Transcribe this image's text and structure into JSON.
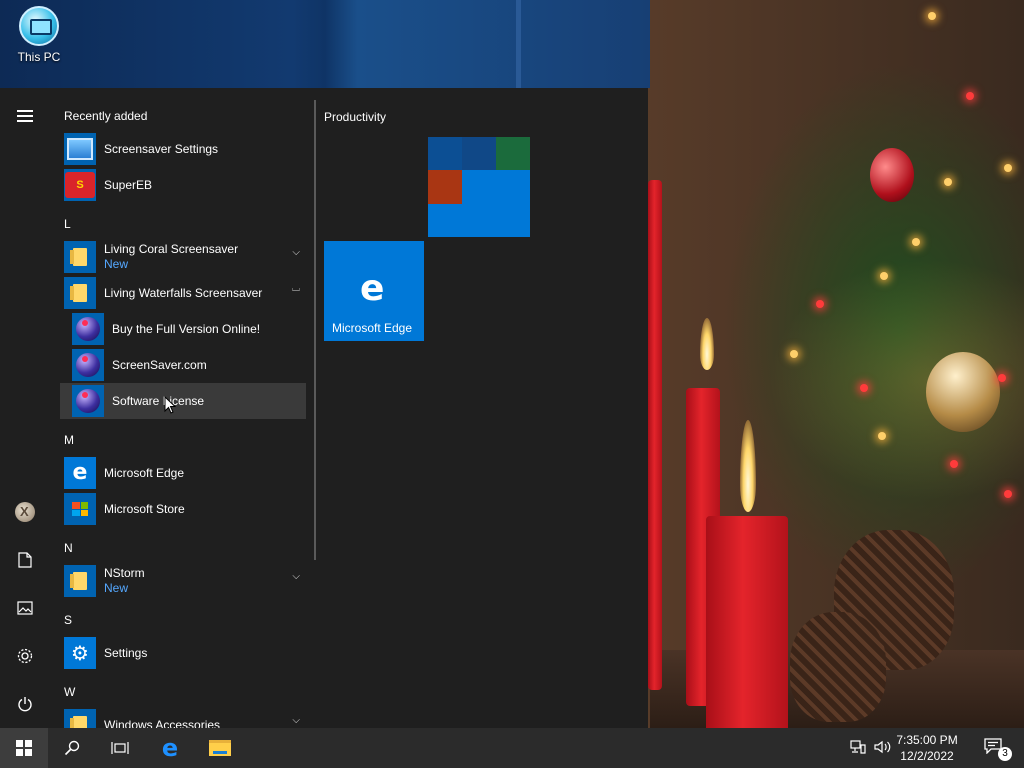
{
  "desktop": {
    "icons": [
      {
        "label": "This PC",
        "icon": "this-pc-icon"
      }
    ]
  },
  "start_menu": {
    "rail": [
      "hamburger-icon",
      "user-avatar",
      "documents-icon",
      "pictures-icon",
      "settings-gear-icon",
      "power-icon"
    ],
    "sections": {
      "recently_added": "Recently added",
      "l": "L",
      "m": "M",
      "n": "N",
      "s": "S",
      "w": "W"
    },
    "apps": {
      "screensaver_settings": "Screensaver Settings",
      "supereb": "SuperEB",
      "living_coral": {
        "label": "Living Coral Screensaver",
        "sub": "New"
      },
      "living_waterfalls": "Living Waterfalls Screensaver",
      "buy_full_version": "Buy the Full Version Online!",
      "screensaver_com": "ScreenSaver.com",
      "software_license": "Software License",
      "microsoft_edge": "Microsoft Edge",
      "microsoft_store": "Microsoft Store",
      "nstorm": {
        "label": "NStorm",
        "sub": "New"
      },
      "settings": "Settings",
      "windows_accessories": "Windows Accessories"
    },
    "tiles": {
      "group_title": "Productivity",
      "edge_tile_label": "Microsoft Edge",
      "grid_colors": [
        "#0c4f94",
        "#104887",
        "#1b6b3c",
        "#a93613",
        "#0078d7",
        "#0078d7",
        "#0078d7",
        "#0078d7",
        "#0078d7"
      ]
    }
  },
  "taskbar": {
    "items": [
      "start-button",
      "search-button",
      "task-view-button",
      "edge-taskbar-button",
      "file-explorer-button"
    ],
    "clock": {
      "time": "7:35:00 PM",
      "date": "12/2/2022"
    },
    "notification_count": "3"
  },
  "colors": {
    "accent": "#0078d7",
    "menu_bg": "#1f1f1f",
    "taskbar_bg": "#2b2b2b",
    "new_badge": "#55a8ff"
  }
}
